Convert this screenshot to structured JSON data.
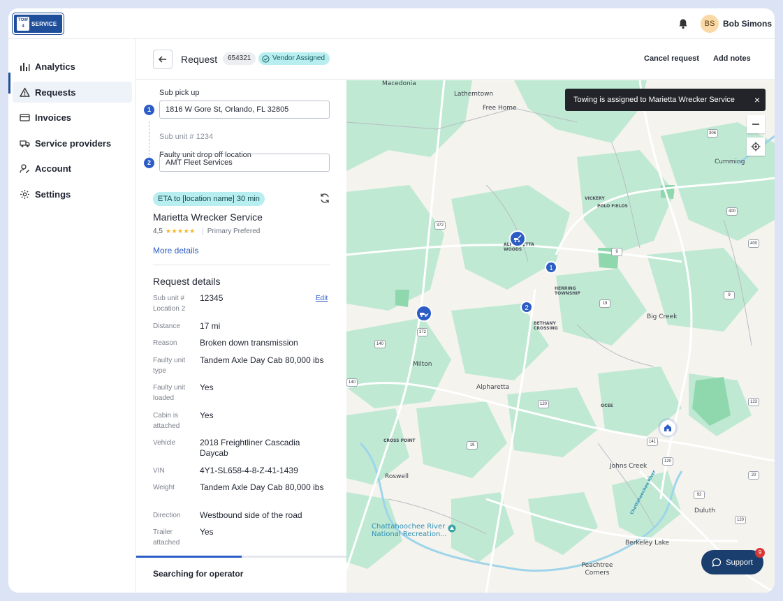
{
  "brand": {
    "logo_top": "TOW",
    "logo_num": "4",
    "logo_text": "SERVICE"
  },
  "user": {
    "initials": "BS",
    "name": "Bob Simons"
  },
  "sidebar": {
    "items": [
      {
        "label": "Analytics",
        "icon": "bar-chart-icon"
      },
      {
        "label": "Requests",
        "icon": "warning-icon",
        "active": true
      },
      {
        "label": "Invoices",
        "icon": "card-icon"
      },
      {
        "label": "Service providers",
        "icon": "truck-icon"
      },
      {
        "label": "Account",
        "icon": "user-edit-icon"
      },
      {
        "label": "Settings",
        "icon": "gear-icon"
      }
    ]
  },
  "header": {
    "title": "Request",
    "request_id": "654321",
    "status": "Vendor Assigned",
    "cancel_label": "Cancel request",
    "notes_label": "Add notes"
  },
  "locations": {
    "pickup_label": "Sub pick up",
    "pickup_step": "1",
    "pickup_value": "1816 W Gore St, Orlando, FL 32805",
    "sub_unit_note": "Sub unit # 1234",
    "dropoff_label": "Faulty unit drop off location",
    "dropoff_step": "2",
    "dropoff_value": "AMT Fleet Services"
  },
  "vendor": {
    "eta": "ETA to [location name] 30 min",
    "name": "Marietta Wrecker Service",
    "rating": "4,5",
    "stars": "★★★★★",
    "preference": "Primary Prefered",
    "more_label": "More details"
  },
  "details": {
    "title": "Request details",
    "edit_label": "Edit",
    "rows": [
      {
        "label": "Sub unit # Location 2",
        "value": "12345"
      },
      {
        "label": "Distance",
        "value": "17 mi"
      },
      {
        "label": "Reason",
        "value": "Broken down transmission"
      },
      {
        "label": "Faulty unit type",
        "value": "Tandem Axle Day Cab 80,000 ibs"
      },
      {
        "label": "Faulty unit loaded",
        "value": "Yes"
      },
      {
        "label": "Cabin is attached",
        "value": "Yes"
      },
      {
        "label": "Vehicle",
        "value": "2018 Freightliner Cascadia Daycab"
      },
      {
        "label": "VIN",
        "value": "4Y1-SL658-4-8-Z-41-1439"
      },
      {
        "label": "Weight",
        "value": "Tandem Axle Day Cab 80,000 ibs"
      },
      {
        "label": "Direction",
        "value": "Westbound side of the road"
      },
      {
        "label": "Trailer attached",
        "value": "Yes"
      }
    ]
  },
  "search_status": {
    "label": "Searching for operator",
    "progress": 0.5
  },
  "map": {
    "toast": "Towing is assigned to Marietta Wrecker Service",
    "toast_close": "×",
    "labels": {
      "macedonia": "Macedonia",
      "lathemtown": "Lathemtown",
      "free_home": "Free Home",
      "cumming": "Cumming",
      "vickery": "VICKERY",
      "polo_fields": "POLO FIELDS",
      "alpharetta_woods": "ALPHARETTA WOODS",
      "herring_township": "HERRING TOWNSHIP",
      "bethany_crossing": "BETHANY CROSSING",
      "big_creek": "Big Creek",
      "milton": "Milton",
      "alpharetta": "Alpharetta",
      "ocee": "OCEE",
      "cross_point": "CROSS POINT",
      "roswell": "Roswell",
      "johns_creek": "Johns Creek",
      "duluth": "Duluth",
      "chattahoochee_nra": "Chattahoochee River National Recreation...",
      "chattahoochee_river": "Chattahoochee River",
      "berkeley_lake": "Berkeley Lake",
      "peachtree_corners": "Peachtree Corners"
    },
    "shields": {
      "r306": "306",
      "r372a": "372",
      "r372b": "372",
      "r9a": "9",
      "r9b": "9",
      "r19a": "19",
      "r19b": "19",
      "r140a": "140",
      "r140b": "140",
      "r120a": "120",
      "r120b": "120",
      "r141": "141",
      "r400a": "400",
      "r400b": "400",
      "r20": "20",
      "r92": "92",
      "r120c": "120",
      "r123": "123"
    },
    "pins": {
      "pickup": "1",
      "dropoff": "2"
    },
    "support_label": "Support",
    "support_count": "9",
    "colors": {
      "park": "#bfe9d3",
      "road": "#ffffff",
      "water": "#9fd5ea"
    }
  }
}
